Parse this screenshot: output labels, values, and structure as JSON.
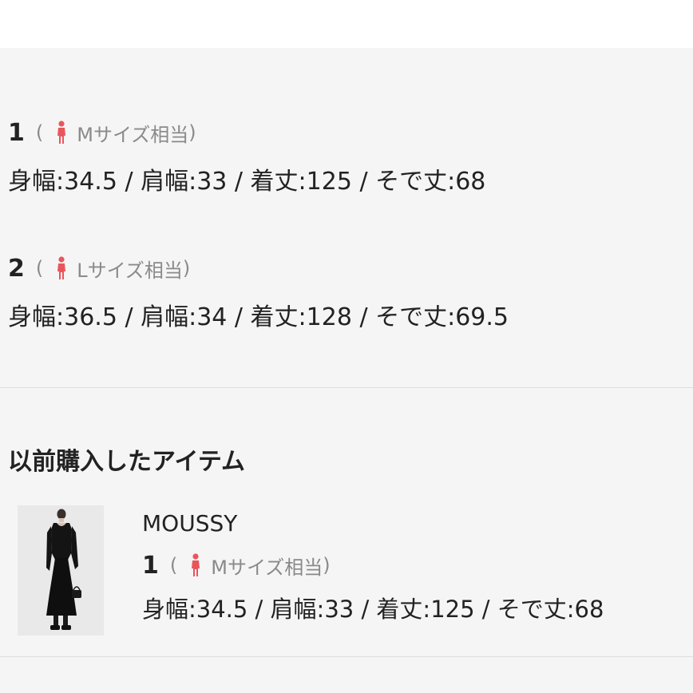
{
  "sizes": [
    {
      "number": "1",
      "open_paren": "(",
      "label": "Mサイズ相当",
      "close_paren": ")",
      "measurements": "身幅:34.5 / 肩幅:33 / 着丈:125 / そで丈:68"
    },
    {
      "number": "2",
      "open_paren": "(",
      "label": "Lサイズ相当",
      "close_paren": ")",
      "measurements": "身幅:36.5 / 肩幅:34 / 着丈:128 / そで丈:69.5"
    }
  ],
  "previous_purchases": {
    "title": "以前購入したアイテム",
    "items": [
      {
        "brand": "MOUSSY",
        "number": "1",
        "open_paren": "(",
        "label": "Mサイズ相当",
        "close_paren": ")",
        "measurements": "身幅:34.5 / 肩幅:33 / 着丈:125 / そで丈:68"
      }
    ]
  },
  "colors": {
    "icon_red": "#e8565c",
    "muted_text": "#8a8a8a",
    "text": "#222222",
    "background": "#f5f5f5"
  },
  "icons": {
    "size_person": "person-icon"
  }
}
